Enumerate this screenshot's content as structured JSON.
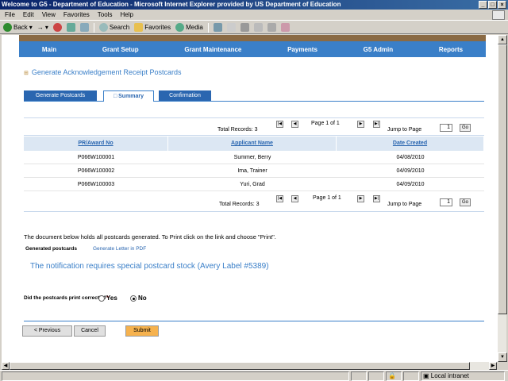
{
  "window": {
    "title": "Welcome to G5 - Department of Education - Microsoft Internet Explorer provided by US Department of Education"
  },
  "menu": [
    "File",
    "Edit",
    "View",
    "Favorites",
    "Tools",
    "Help"
  ],
  "toolbar": {
    "back": "Back",
    "search": "Search",
    "favorites": "Favorites",
    "media": "Media"
  },
  "nav": [
    "Main",
    "Grant Setup",
    "Grant Maintenance",
    "Payments",
    "G5 Admin",
    "Reports"
  ],
  "page": {
    "title": "Generate Acknowledgement Receipt Postcards"
  },
  "tabs": [
    {
      "label": "Generate Postcards"
    },
    {
      "label": "Summary"
    },
    {
      "label": "Confirmation"
    }
  ],
  "pager": {
    "total_label": "Total Records: 3",
    "page_label": "Page 1 of 1",
    "jump_label": "Jump to Page",
    "jump_value": "1",
    "go_label": "Go"
  },
  "table": {
    "columns": [
      "PR/Award No",
      "Applicant Name",
      "Date Created"
    ],
    "rows": [
      [
        "P066W100001",
        "Summer, Berry",
        "04/08/2010"
      ],
      [
        "P066W100002",
        "Ima, Trainer",
        "04/09/2010"
      ],
      [
        "P066W100003",
        "Yuri, Grad",
        "04/09/2010"
      ]
    ]
  },
  "note": "The document below holds all postcards generated. To Print click on the link and choose \"Print\".",
  "generated": {
    "label": "Generated postcards",
    "link": "Generate Letter in PDF"
  },
  "notification": "The notification requires special postcard stock (Avery Label #5389)",
  "question": {
    "text": "Did the postcards print correctly?",
    "required": "*",
    "yes": "Yes",
    "no": "No",
    "selected": "No"
  },
  "buttons": {
    "previous": "< Previous",
    "cancel": "Cancel",
    "submit": "Submit"
  },
  "status": {
    "zone": "Local intranet"
  },
  "colors": {
    "nav": "#3a7fc8",
    "tab_dark": "#2a66b0",
    "submit": "#f6b24e"
  }
}
